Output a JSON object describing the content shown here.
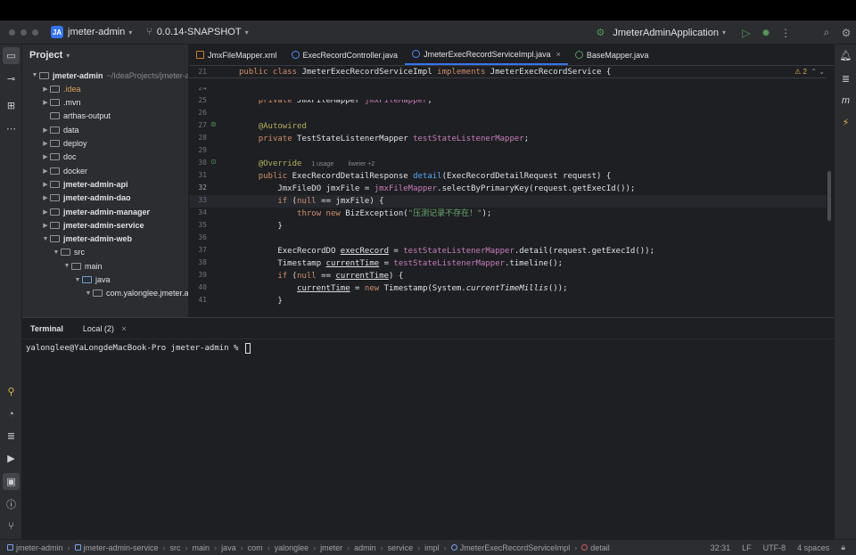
{
  "titlebar": {
    "project_badge": "JA",
    "project_name": "jmeter-admin",
    "branch": "0.0.14-SNAPSHOT",
    "run_config": "JmeterAdminApplication"
  },
  "project_panel": {
    "title": "Project",
    "tree": [
      {
        "label": "jmeter-admin",
        "extra": "~/IdeaProjects/jmeter-ad",
        "level": 0,
        "expanded": true,
        "bold": true
      },
      {
        "label": ".idea",
        "level": 1,
        "expanded": false,
        "color": "orange"
      },
      {
        "label": ".mvn",
        "level": 1,
        "expanded": false
      },
      {
        "label": "arthas-output",
        "level": 1,
        "leaf": true
      },
      {
        "label": "data",
        "level": 1,
        "expanded": false
      },
      {
        "label": "deploy",
        "level": 1,
        "expanded": false
      },
      {
        "label": "doc",
        "level": 1,
        "expanded": false
      },
      {
        "label": "docker",
        "level": 1,
        "expanded": false
      },
      {
        "label": "jmeter-admin-api",
        "level": 1,
        "expanded": false,
        "bold": true
      },
      {
        "label": "jmeter-admin-dao",
        "level": 1,
        "expanded": false,
        "bold": true
      },
      {
        "label": "jmeter-admin-manager",
        "level": 1,
        "expanded": false,
        "bold": true
      },
      {
        "label": "jmeter-admin-service",
        "level": 1,
        "expanded": false,
        "bold": true
      },
      {
        "label": "jmeter-admin-web",
        "level": 1,
        "expanded": true,
        "bold": true
      },
      {
        "label": "src",
        "level": 2,
        "expanded": true
      },
      {
        "label": "main",
        "level": 3,
        "expanded": true
      },
      {
        "label": "java",
        "level": 4,
        "expanded": true,
        "src": true
      },
      {
        "label": "com.yalonglee.jmeter.ad",
        "level": 5,
        "expanded": true
      }
    ]
  },
  "editor": {
    "tabs": [
      {
        "label": "JmxFileMapper.xml",
        "kind": "xml",
        "active": false
      },
      {
        "label": "ExecRecordController.java",
        "kind": "class",
        "active": false
      },
      {
        "label": "JmeterExecRecordServiceImpl.java",
        "kind": "class",
        "active": true,
        "close": "×"
      },
      {
        "label": "BaseMapper.java",
        "kind": "iface",
        "active": false
      }
    ],
    "warnings": "⚠ 2",
    "sticky_line_number": "21",
    "line_numbers": [
      "24",
      "25",
      "26",
      "27",
      "28",
      "29",
      "30",
      "31",
      "32",
      "33",
      "34",
      "35",
      "36",
      "37",
      "38",
      "39",
      "40",
      "41"
    ],
    "current_line": "32",
    "usage_hint": "1 usage",
    "author_hint": "liweier +2"
  },
  "terminal": {
    "title": "Terminal",
    "tab_label": "Local (2)",
    "tab_close": "×",
    "prompt": "yalonglee@YaLongdeMacBook-Pro jmeter-admin % "
  },
  "statusbar": {
    "breadcrumbs": [
      "jmeter-admin",
      "jmeter-admin-service",
      "src",
      "main",
      "java",
      "com",
      "yalonglee",
      "jmeter",
      "admin",
      "service",
      "impl",
      "JmeterExecRecordServiceImpl",
      "detail"
    ],
    "position": "32:31",
    "line_sep": "LF",
    "encoding": "UTF-8",
    "indent": "4 spaces"
  },
  "colors": {
    "accent": "#3574f0",
    "background": "#1e1f22",
    "panel": "#2b2d30",
    "keyword": "#cf8e6d",
    "field": "#c77dbb",
    "method": "#56a8f5",
    "string": "#6aab73",
    "annotation": "#b3ae60"
  }
}
